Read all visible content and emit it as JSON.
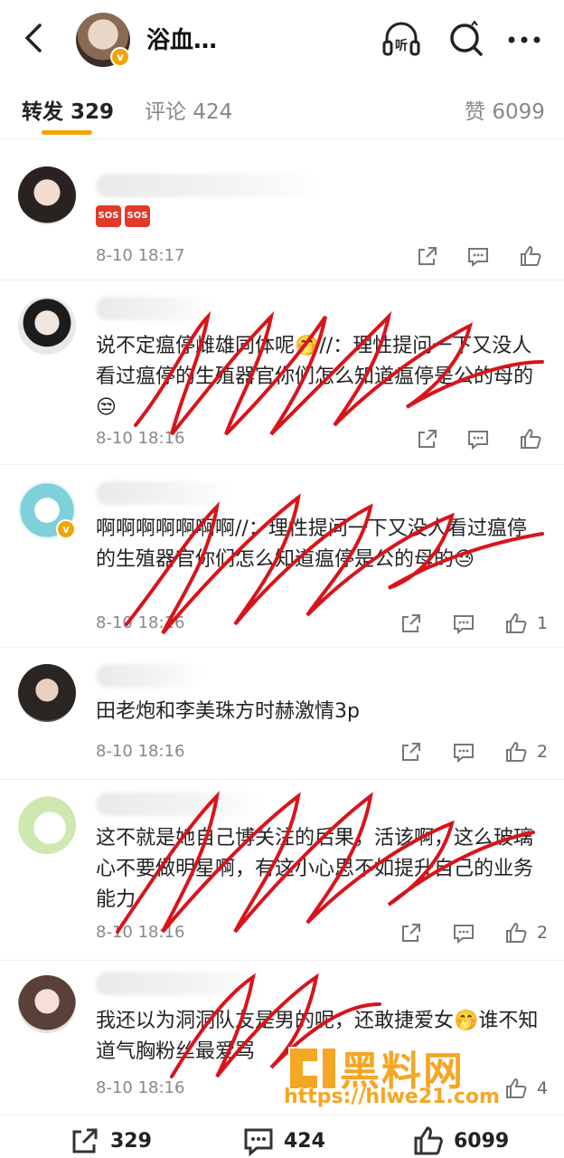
{
  "header": {
    "title": "浴血…",
    "verified_badge": "v",
    "listen_icon": "headphones-icon",
    "listen_label": "听",
    "search_icon": "search-icon",
    "more_icon": "more-icon"
  },
  "tabs": [
    {
      "label": "转发",
      "count": "329",
      "active": true
    },
    {
      "label": "评论",
      "count": "424",
      "active": false
    },
    {
      "label": "赞",
      "count": "6099",
      "active": false
    }
  ],
  "comments": [
    {
      "text": "",
      "sos": [
        "SOS",
        "SOS"
      ],
      "time": "8-10 18:17",
      "likes": ""
    },
    {
      "text": "说不定瘟停雌雄同体呢🤭//：理性提问一下又没人看过瘟停的生殖器官你们怎么知道瘟停是公的母的😒",
      "time": "8-10 18:16",
      "likes": ""
    },
    {
      "text": "啊啊啊啊啊啊啊//：理性提问一下又没人看过瘟停的生殖器官你们怎么知道瘟停是公的母的😓",
      "time": "8-10 18:16",
      "likes": "1"
    },
    {
      "text": "田老炮和李美珠方时赫激情3p",
      "time": "8-10 18:16",
      "likes": "2"
    },
    {
      "text": "这不就是她自己博关注的后果，活该啊，这么玻璃心不要做明星啊，有这小心思不如提升自己的业务能力",
      "time": "8-10 18:16",
      "likes": "2"
    },
    {
      "text": "我还以为洞洞队友是男的呢，还敢捷爱女🤭谁不知道气胸粉丝最爱骂",
      "time": "8-10 18:16",
      "likes": "4"
    }
  ],
  "bottom_bar": {
    "repost_count": "329",
    "comment_count": "424",
    "like_count": "6099"
  },
  "watermark": {
    "text": "黑料网",
    "url": "https://hlwe21.com"
  },
  "colors": {
    "accent": "#f2a400",
    "scribble": "#d8141b",
    "watermark": "#f5a623"
  }
}
